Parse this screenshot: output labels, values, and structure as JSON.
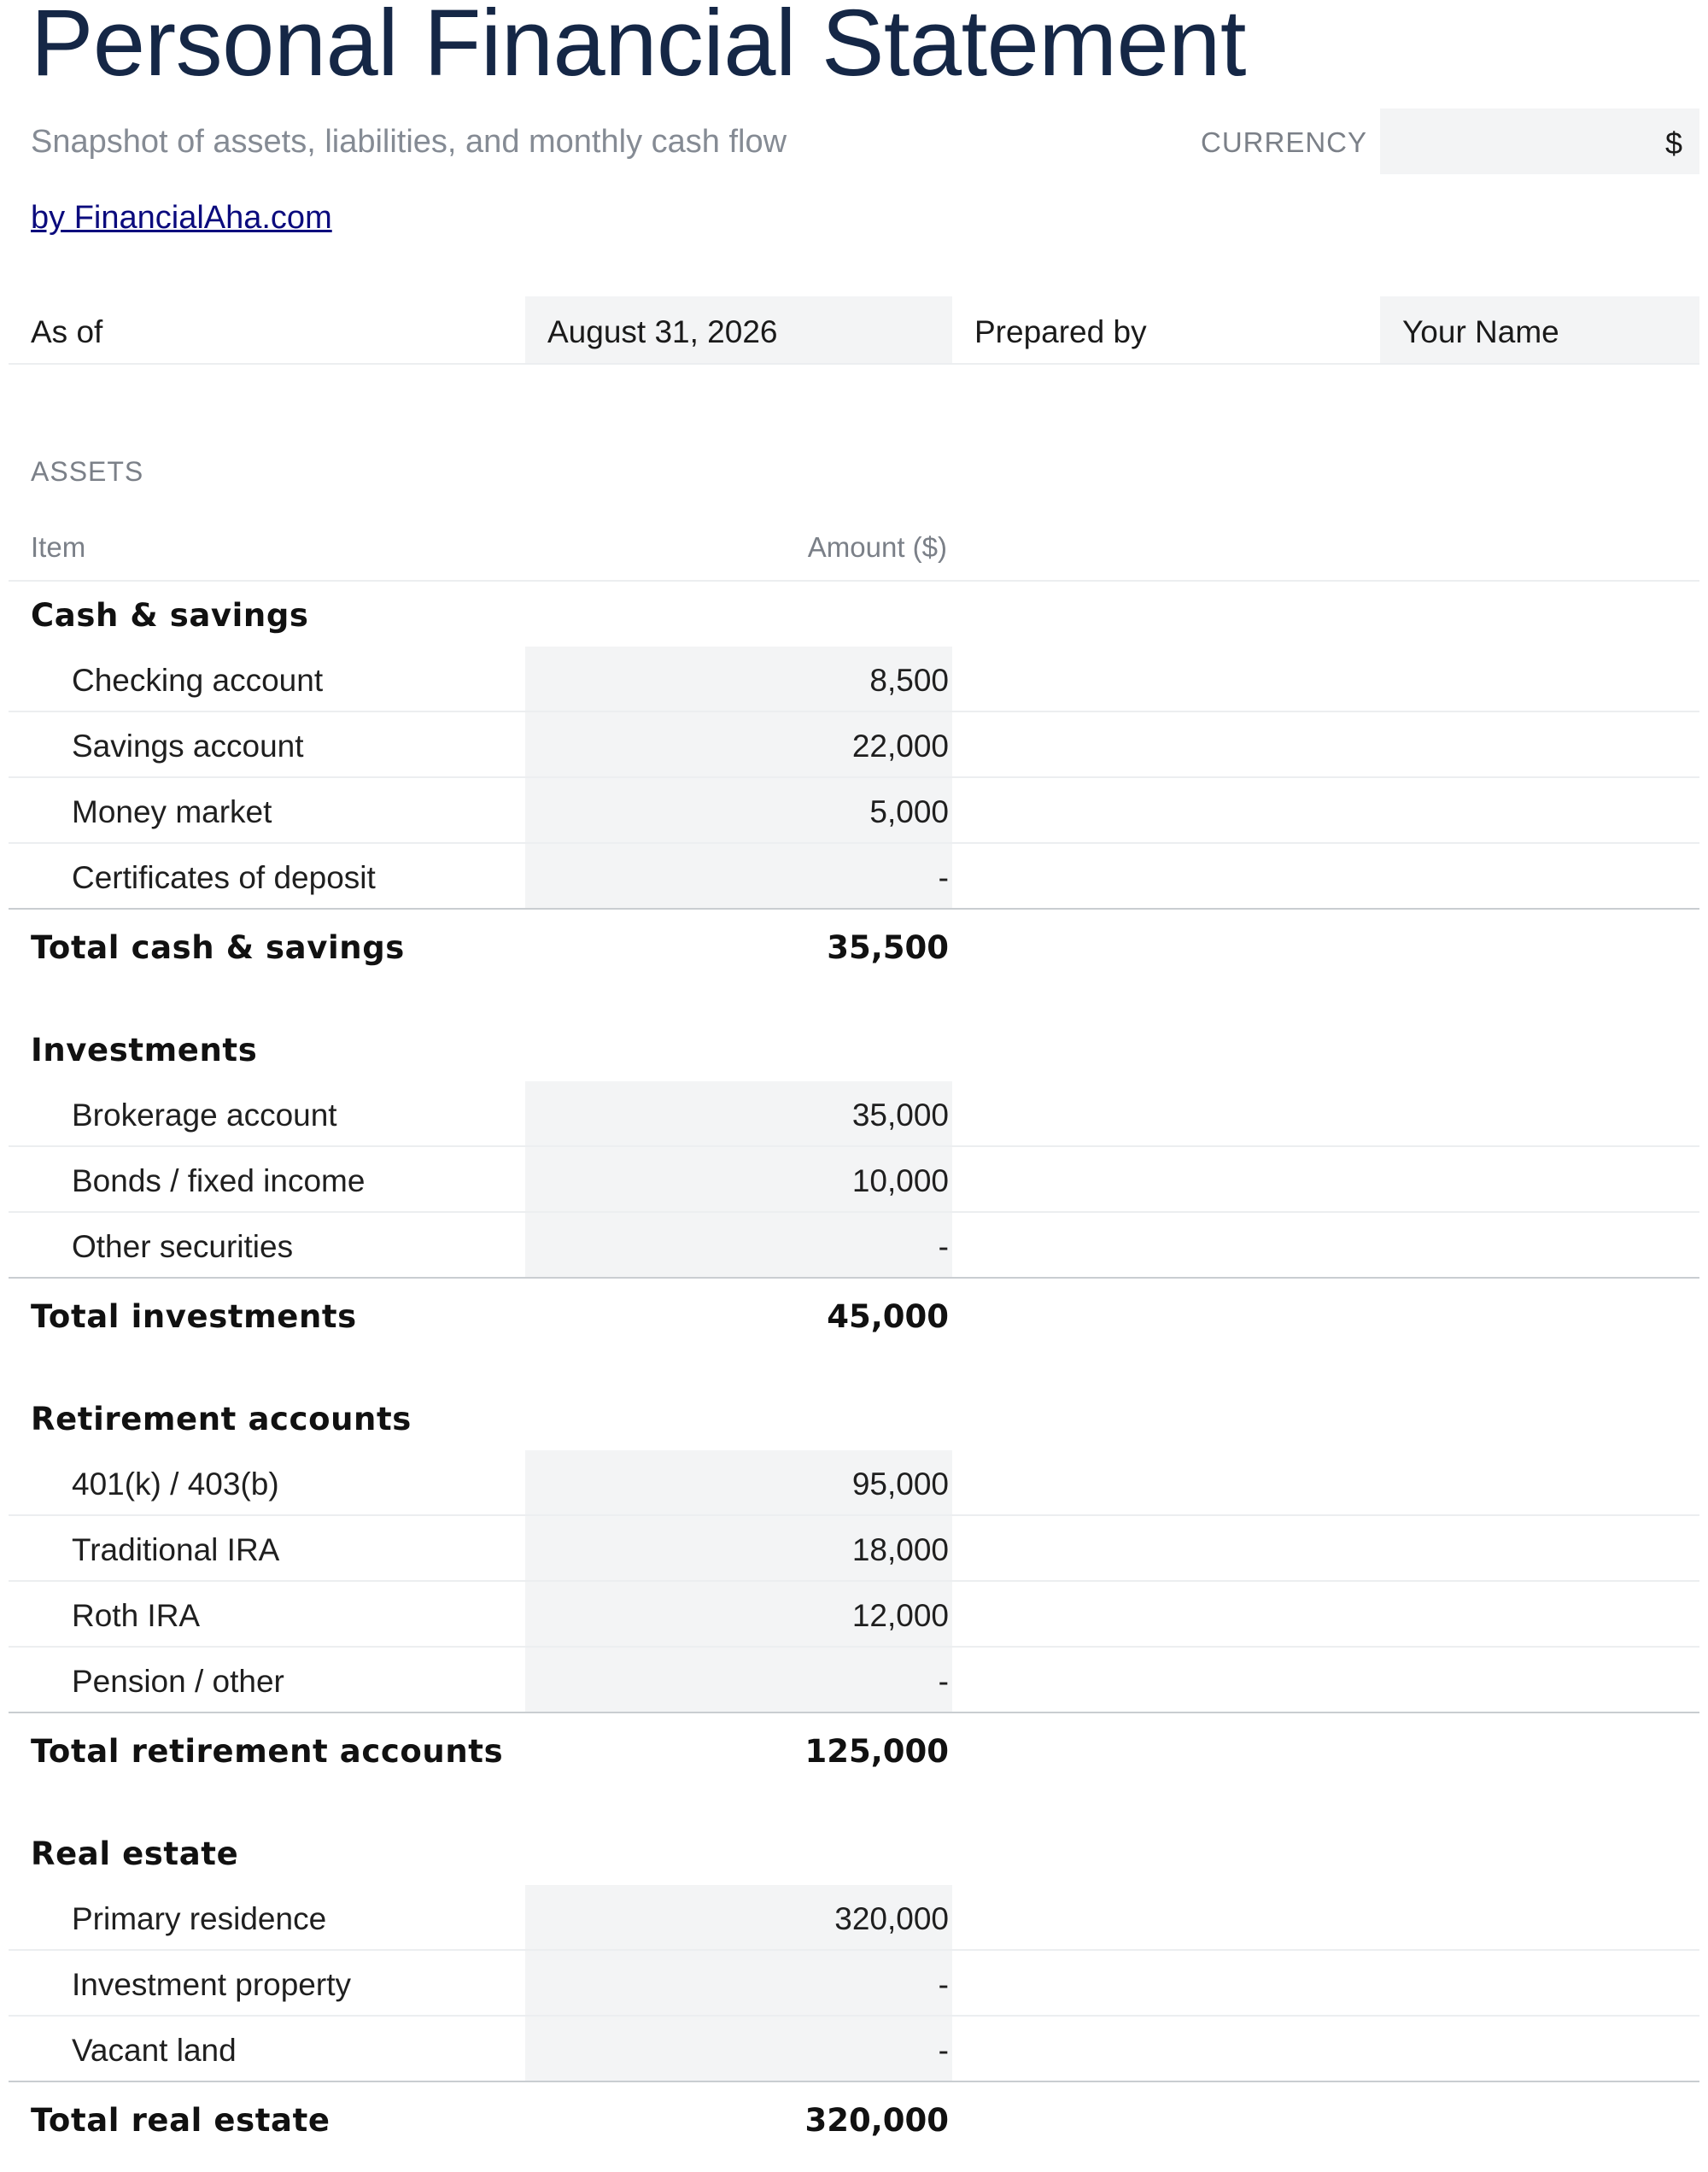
{
  "header": {
    "title": "Personal Financial Statement",
    "subtitle": "Snapshot of assets, liabilities, and monthly cash flow",
    "currency_label": "CURRENCY",
    "currency_value": "$",
    "byline": "by FinancialAha.com"
  },
  "meta": {
    "as_of_label": "As of",
    "as_of_value": "August 31, 2026",
    "prepared_by_label": "Prepared by",
    "prepared_by_value": "Your Name"
  },
  "assets": {
    "section_label": "ASSETS",
    "col_item": "Item",
    "col_amount": "Amount ($)",
    "groups": [
      {
        "title": "Cash & savings",
        "items": [
          {
            "label": "Checking account",
            "amount": "8,500"
          },
          {
            "label": "Savings account",
            "amount": "22,000"
          },
          {
            "label": "Money market",
            "amount": "5,000"
          },
          {
            "label": "Certificates of deposit",
            "amount": "-"
          }
        ],
        "total_label": "Total cash & savings",
        "total_amount": "35,500"
      },
      {
        "title": "Investments",
        "items": [
          {
            "label": "Brokerage account",
            "amount": "35,000"
          },
          {
            "label": "Bonds / fixed income",
            "amount": "10,000"
          },
          {
            "label": "Other securities",
            "amount": "-"
          }
        ],
        "total_label": "Total investments",
        "total_amount": "45,000"
      },
      {
        "title": "Retirement accounts",
        "items": [
          {
            "label": "401(k) / 403(b)",
            "amount": "95,000"
          },
          {
            "label": "Traditional IRA",
            "amount": "18,000"
          },
          {
            "label": "Roth IRA",
            "amount": "12,000"
          },
          {
            "label": "Pension / other",
            "amount": "-"
          }
        ],
        "total_label": "Total retirement accounts",
        "total_amount": "125,000"
      },
      {
        "title": "Real estate",
        "items": [
          {
            "label": "Primary residence",
            "amount": "320,000"
          },
          {
            "label": "Investment property",
            "amount": "-"
          },
          {
            "label": "Vacant land",
            "amount": "-"
          }
        ],
        "total_label": "Total real estate",
        "total_amount": "320,000"
      }
    ]
  }
}
